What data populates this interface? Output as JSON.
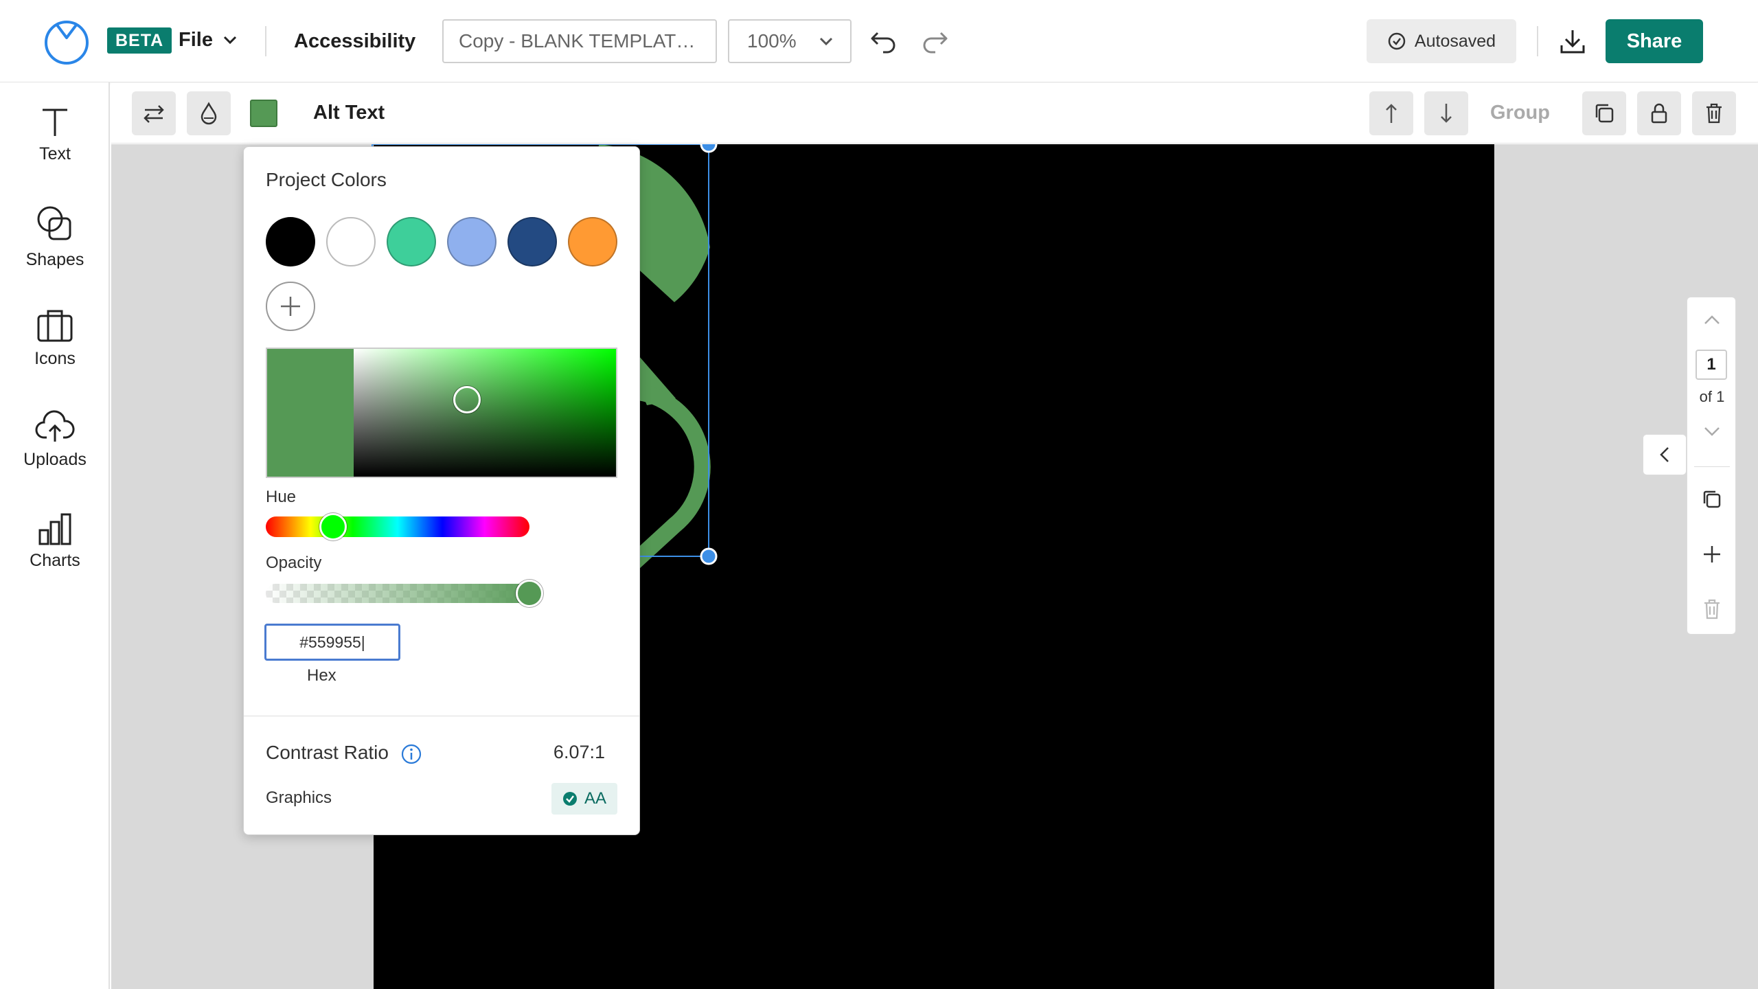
{
  "header": {
    "beta_badge": "BETA",
    "file_menu_label": "File",
    "accessibility_label": "Accessibility",
    "doc_title": "Copy - BLANK TEMPLAT…",
    "zoom_value": "100%",
    "autosaved_label": "Autosaved",
    "share_label": "Share"
  },
  "sidebar": {
    "items": [
      {
        "label": "Text",
        "icon": "text-icon"
      },
      {
        "label": "Shapes",
        "icon": "shapes-icon"
      },
      {
        "label": "Icons",
        "icon": "briefcase-icon"
      },
      {
        "label": "Uploads",
        "icon": "cloud-upload-icon"
      },
      {
        "label": "Charts",
        "icon": "bar-chart-icon"
      }
    ]
  },
  "toolbar": {
    "fill_color": "#559955",
    "alt_text_label": "Alt Text",
    "group_label": "Group"
  },
  "color_picker": {
    "title": "Project Colors",
    "project_colors": [
      "#000000",
      "#ffffff",
      "#3ecf9a",
      "#8fb0ee",
      "#234a82",
      "#ff9a33"
    ],
    "hue_label": "Hue",
    "opacity_label": "Opacity",
    "hex_value": "#559955|",
    "hex_label": "Hex",
    "contrast_label": "Contrast Ratio",
    "contrast_value": "6.07:1",
    "graphics_label": "Graphics",
    "graphics_rating": "AA"
  },
  "page_nav": {
    "current_page": "1",
    "total_label": "of 1"
  },
  "colors": {
    "brand": "#0a7d6e",
    "selection": "#3d8fe6",
    "shape_fill": "#559955"
  }
}
